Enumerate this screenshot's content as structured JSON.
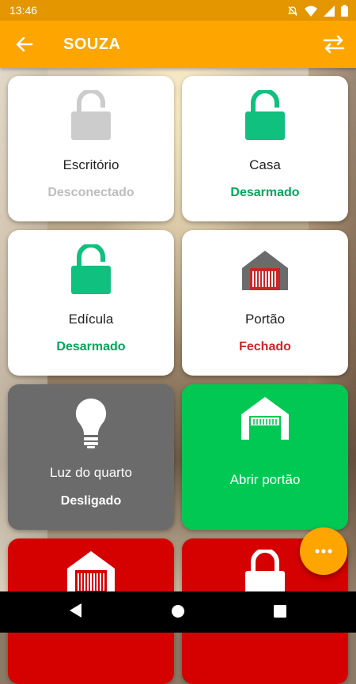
{
  "status_bar": {
    "time": "13:46",
    "icons": [
      "mute-icon",
      "wifi-icon",
      "signal-icon",
      "battery-icon"
    ]
  },
  "app_bar": {
    "title": "SOUZA",
    "back_icon": "arrow-left-icon",
    "action_icon": "swap-icon"
  },
  "colors": {
    "accent": "#ffa500",
    "status_green": "#00a65a",
    "status_red": "#c62828",
    "status_gray": "#bdbdbd",
    "tile_gray": "#6b6b6b",
    "tile_green": "#00c853",
    "tile_red": "#d50000"
  },
  "tiles": [
    {
      "name": "Escritório",
      "status": "Desconectado",
      "icon": "padlock-gray-icon"
    },
    {
      "name": "Casa",
      "status": "Desarmado",
      "icon": "padlock-green-icon"
    },
    {
      "name": "Edícula",
      "status": "Desarmado",
      "icon": "padlock-green-icon"
    },
    {
      "name": "Portão",
      "status": "Fechado",
      "icon": "garage-icon"
    },
    {
      "name": "Luz do quarto",
      "status": "Desligado",
      "icon": "lightbulb-icon"
    },
    {
      "name": "Abrir portão",
      "icon": "gate-icon"
    },
    {
      "icon": "garage-icon"
    },
    {
      "icon": "padlock-icon"
    }
  ],
  "fab": {
    "icon": "more-horizontal-icon"
  },
  "nav_bar": {
    "buttons": [
      "back-triangle-icon",
      "home-circle-icon",
      "recents-square-icon"
    ]
  }
}
